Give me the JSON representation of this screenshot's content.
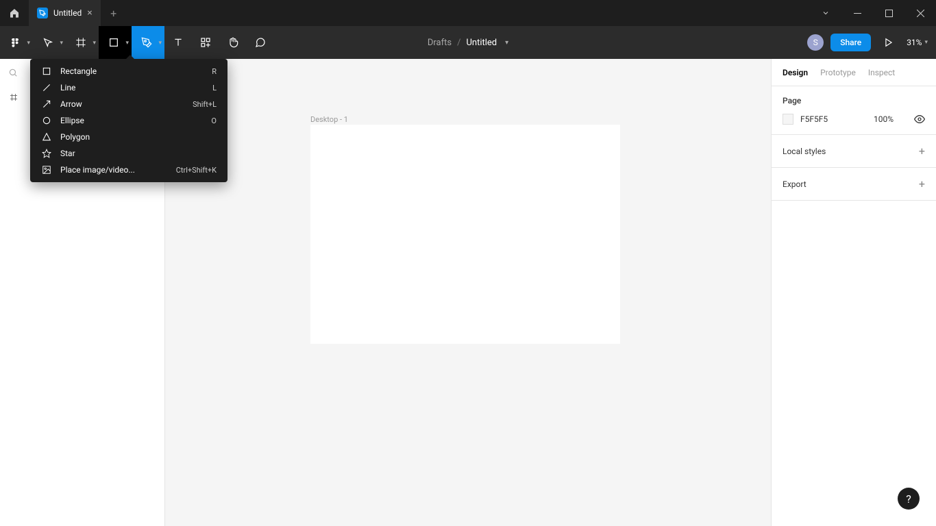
{
  "titlebar": {
    "tab_title": "Untitled"
  },
  "toolbar": {
    "breadcrumb_root": "Drafts",
    "breadcrumb_sep": "/",
    "breadcrumb_title": "Untitled",
    "avatar_initial": "S",
    "share_label": "Share",
    "zoom_label": "31%"
  },
  "shape_menu": {
    "items": [
      {
        "label": "Rectangle",
        "shortcut": "R"
      },
      {
        "label": "Line",
        "shortcut": "L"
      },
      {
        "label": "Arrow",
        "shortcut": "Shift+L"
      },
      {
        "label": "Ellipse",
        "shortcut": "O"
      },
      {
        "label": "Polygon",
        "shortcut": ""
      },
      {
        "label": "Star",
        "shortcut": ""
      },
      {
        "label": "Place image/video...",
        "shortcut": "Ctrl+Shift+K"
      }
    ]
  },
  "canvas": {
    "frame_label": "Desktop - 1"
  },
  "right_panel": {
    "tabs": {
      "design": "Design",
      "prototype": "Prototype",
      "inspect": "Inspect"
    },
    "page_title": "Page",
    "page_hex": "F5F5F5",
    "page_opacity": "100%",
    "local_styles": "Local styles",
    "export": "Export"
  },
  "help": "?"
}
